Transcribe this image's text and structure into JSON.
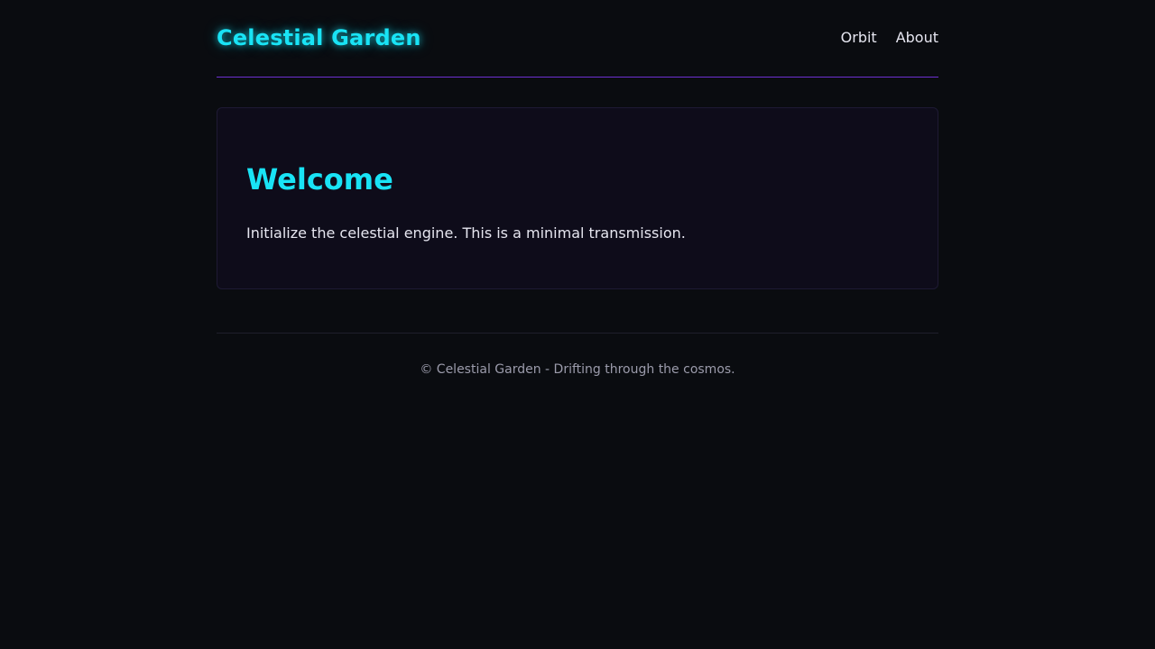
{
  "header": {
    "brand": "Celestial Garden",
    "nav": [
      {
        "label": "Orbit"
      },
      {
        "label": "About"
      }
    ]
  },
  "main": {
    "title": "Welcome",
    "body": "Initialize the celestial engine. This is a minimal transmission."
  },
  "footer": {
    "text": "© Celestial Garden - Drifting through the cosmos."
  },
  "colors": {
    "background": "#0a0c10",
    "accent": "#19e3f5",
    "divider": "#6d2fd0",
    "card": "#0e0c1a"
  }
}
